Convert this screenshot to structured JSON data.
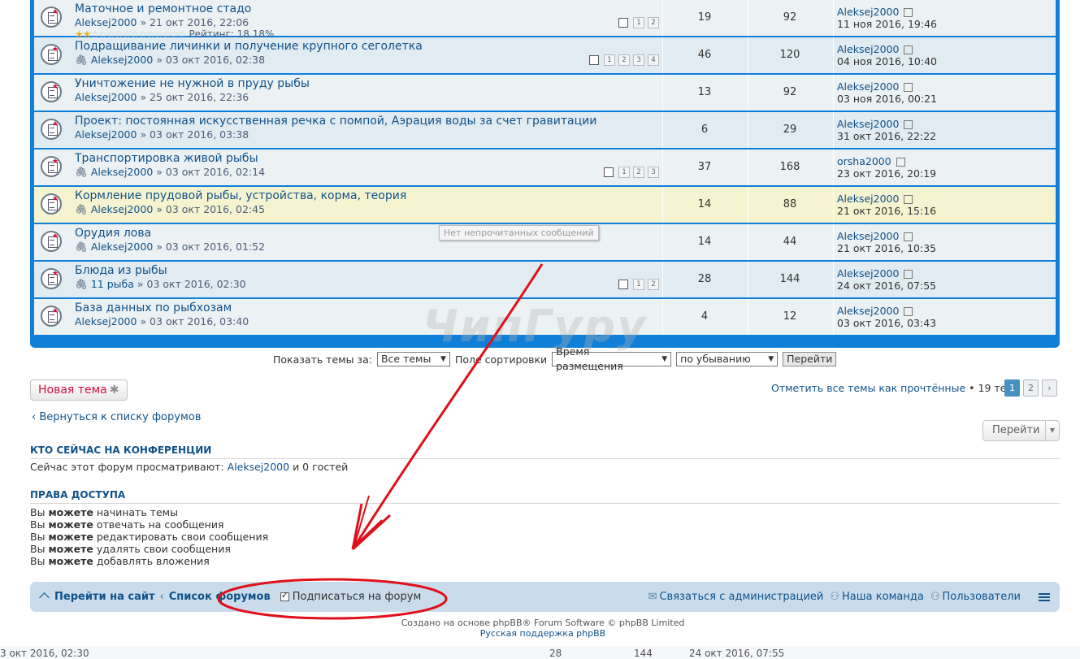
{
  "topics": [
    {
      "title": "Маточное и ремонтное стадо",
      "author": "Aleksej2000",
      "date": "» 21 окт 2016, 22:06",
      "attach": false,
      "rating": "Рейтинг: 18.18%",
      "pages": [
        "1",
        "2"
      ],
      "replies": "19",
      "views": "92",
      "last_user": "Aleksej2000",
      "last_date": "11 ноя 2016, 19:46",
      "hl": false
    },
    {
      "title": "Подращивание личинки и получение крупного сеголетка",
      "author": "Aleksej2000",
      "date": "» 03 окт 2016, 02:38",
      "attach": true,
      "rating": "",
      "pages": [
        "1",
        "2",
        "3",
        "4"
      ],
      "replies": "46",
      "views": "120",
      "last_user": "Aleksej2000",
      "last_date": "04 ноя 2016, 10:40",
      "hl": false
    },
    {
      "title": "Уничтожение не нужной в пруду рыбы",
      "author": "Aleksej2000",
      "date": "» 25 окт 2016, 22:36",
      "attach": false,
      "rating": "",
      "pages": [],
      "replies": "13",
      "views": "92",
      "last_user": "Aleksej2000",
      "last_date": "03 ноя 2016, 00:21",
      "hl": false
    },
    {
      "title": "Проект: постоянная искусственная речка с помпой, Аэрация воды за счет гравитации",
      "author": "Aleksej2000",
      "date": "» 03 окт 2016, 03:38",
      "attach": false,
      "rating": "",
      "pages": [],
      "replies": "6",
      "views": "29",
      "last_user": "Aleksej2000",
      "last_date": "31 окт 2016, 22:22",
      "hl": false
    },
    {
      "title": "Транспортировка живой рыбы",
      "author": "Aleksej2000",
      "date": "» 03 окт 2016, 02:14",
      "attach": true,
      "rating": "",
      "pages": [
        "1",
        "2",
        "3"
      ],
      "replies": "37",
      "views": "168",
      "last_user": "orsha2000",
      "last_date": "23 окт 2016, 20:19",
      "hl": false
    },
    {
      "title": "Кормление прудовой рыбы, устройства, корма, теория",
      "author": "Aleksej2000",
      "date": "» 03 окт 2016, 02:45",
      "attach": true,
      "rating": "",
      "pages": [],
      "replies": "14",
      "views": "88",
      "last_user": "Aleksej2000",
      "last_date": "21 окт 2016, 15:16",
      "hl": true
    },
    {
      "title": "Орудия лова",
      "author": "Aleksej2000",
      "date": "» 03 окт 2016, 01:52",
      "attach": true,
      "rating": "",
      "pages": [],
      "replies": "14",
      "views": "44",
      "last_user": "Aleksej2000",
      "last_date": "21 окт 2016, 10:35",
      "hl": false
    },
    {
      "title": "Блюда из рыбы",
      "author": "11 рыба",
      "date": "» 03 окт 2016, 02:30",
      "attach": true,
      "rating": "",
      "pages": [
        "1",
        "2"
      ],
      "replies": "28",
      "views": "144",
      "last_user": "Aleksej2000",
      "last_date": "24 окт 2016, 07:55",
      "hl": false
    },
    {
      "title": "База данных по рыбхозам",
      "author": "Aleksej2000",
      "date": "» 03 окт 2016, 03:40",
      "attach": false,
      "rating": "",
      "pages": [],
      "replies": "4",
      "views": "12",
      "last_user": "Aleksej2000",
      "last_date": "03 окт 2016, 03:43",
      "hl": false
    }
  ],
  "tooltip": "Нет непрочитанных сообщений",
  "watermark": "ЧипГуру",
  "sort": {
    "show_label": "Показать темы за:",
    "show_value": "Все темы",
    "sort_label": "Поле сортировки",
    "sort_value": "Время размещения",
    "order_value": "по убыванию",
    "go": "Перейти"
  },
  "new_topic": "Новая тема",
  "mark_read": "Отметить все темы как прочтённые",
  "topic_count": "• 19 тем",
  "pagination": [
    "1",
    "2"
  ],
  "back_link": "Вернуться к списку форумов",
  "jump": "Перейти",
  "online": {
    "heading": "КТО СЕЙЧАС НА КОНФЕРЕНЦИИ",
    "prefix": "Сейчас этот форум просматривают:",
    "user": "Aleksej2000",
    "suffix": "и 0 гостей"
  },
  "perms": {
    "heading": "ПРАВА ДОСТУПА",
    "items": [
      {
        "pre": "Вы",
        "bold": "можете",
        "post": "начинать темы"
      },
      {
        "pre": "Вы",
        "bold": "можете",
        "post": "отвечать на сообщения"
      },
      {
        "pre": "Вы",
        "bold": "можете",
        "post": "редактировать свои сообщения"
      },
      {
        "pre": "Вы",
        "bold": "можете",
        "post": "удалять свои сообщения"
      },
      {
        "pre": "Вы",
        "bold": "можете",
        "post": "добавлять вложения"
      }
    ]
  },
  "navbar": {
    "site": "Перейти на сайт",
    "forums": "Список форумов",
    "subscribe": "Подписаться на форум",
    "contact": "Связаться с администрацией",
    "team": "Наша команда",
    "users": "Пользователи"
  },
  "copyright": {
    "line1": "Создано на основе phpBB® Forum Software © phpBB Limited",
    "line2": "Русская поддержка phpBB"
  },
  "bleed": {
    "left": "3 окт 2016, 02:30",
    "mid1": "28",
    "mid2": "144",
    "right": "24 окт 2016, 07:55"
  },
  "colors": {
    "accent": "#0f7fd8",
    "link": "#105289",
    "annotation": "#e0101a"
  }
}
